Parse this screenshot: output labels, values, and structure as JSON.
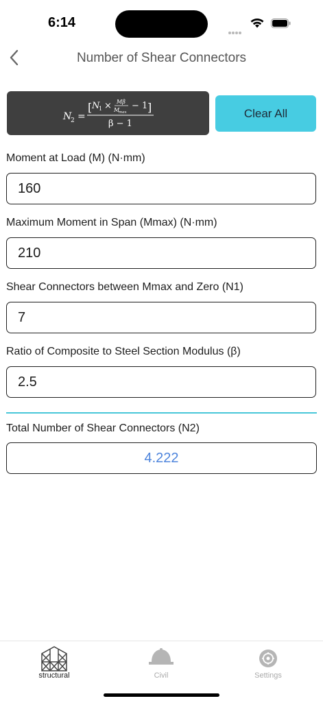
{
  "status": {
    "time": "6:14"
  },
  "nav": {
    "title": "Number of Shear Connectors",
    "back_icon": "chevron-left-icon"
  },
  "formula": {
    "lhs": "N",
    "lhs_sub": "2",
    "equals": "=",
    "bracket_open": "[",
    "n1": "N",
    "n1_sub": "1",
    "times": "×",
    "frac_top": "Mβ",
    "frac_bot": "M",
    "frac_bot_sub": "max",
    "minus_one": "− 1",
    "bracket_close": "]",
    "denominator": "β − 1"
  },
  "actions": {
    "clear_label": "Clear All",
    "accent_color": "#47cce2"
  },
  "fields": [
    {
      "label": "Moment at Load (M) (N·mm)",
      "value": "160"
    },
    {
      "label": "Maximum Moment in Span (Mmax) (N·mm)",
      "value": "210"
    },
    {
      "label": "Shear Connectors between Mmax and Zero (N1)",
      "value": "7"
    },
    {
      "label": "Ratio of Composite to Steel Section Modulus (β)",
      "value": "2.5"
    }
  ],
  "result": {
    "label": "Total Number of Shear Connectors (N2)",
    "value": "4.222",
    "color": "#4d84dc"
  },
  "tabs": [
    {
      "label": "structural",
      "icon": "structure-frame-icon",
      "active": true
    },
    {
      "label": "Civil",
      "icon": "hard-hat-icon",
      "active": false
    },
    {
      "label": "Settings",
      "icon": "gear-icon",
      "active": false
    }
  ]
}
